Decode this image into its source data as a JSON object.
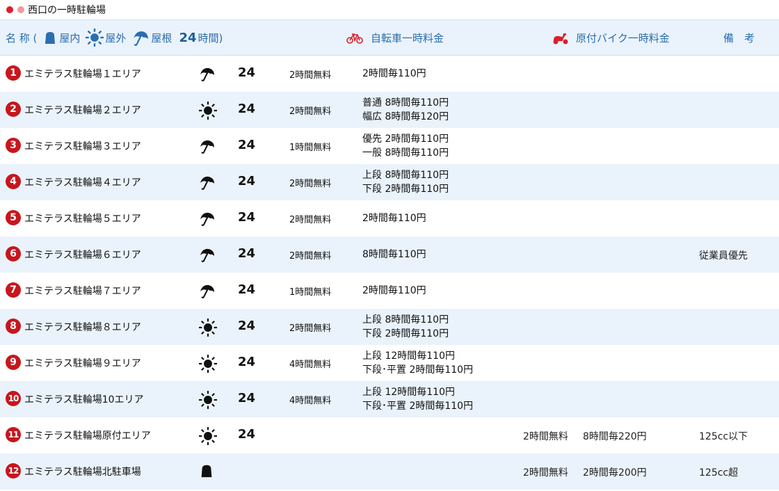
{
  "title": "西口の一時駐輪場",
  "header": {
    "name_label": "名 称 (",
    "indoor_label": "屋内",
    "outdoor_label": "屋外",
    "roof_label": "屋根",
    "hours_num": "24",
    "hours_label": "時間)",
    "bicycle_label": "自転車一時料金",
    "moped_label": "原付バイク一時料金",
    "note_label": "備　考"
  },
  "colors": {
    "accent": "#2a6db0",
    "badge": "#c8161d",
    "row_alt": "#eaf3fb"
  },
  "rows": [
    {
      "num": "1",
      "name": "エミテラス駐輪場１エリア",
      "icon": "umbrella-icon",
      "hours": "24",
      "free": "2時間無料",
      "fee": [
        "2時間毎110円"
      ],
      "moto_free": "",
      "moto_fee": "",
      "note": ""
    },
    {
      "num": "2",
      "name": "エミテラス駐輪場２エリア",
      "icon": "sun-icon",
      "hours": "24",
      "free": "2時間無料",
      "fee": [
        "普通 8時間毎110円",
        "幅広 8時間毎120円"
      ],
      "moto_free": "",
      "moto_fee": "",
      "note": ""
    },
    {
      "num": "3",
      "name": "エミテラス駐輪場３エリア",
      "icon": "umbrella-icon",
      "hours": "24",
      "free": "1時間無料",
      "fee": [
        "優先 2時間毎110円",
        "一般 8時間毎110円"
      ],
      "moto_free": "",
      "moto_fee": "",
      "note": ""
    },
    {
      "num": "4",
      "name": "エミテラス駐輪場４エリア",
      "icon": "umbrella-icon",
      "hours": "24",
      "free": "2時間無料",
      "fee": [
        "上段 8時間毎110円",
        "下段 2時間毎110円"
      ],
      "moto_free": "",
      "moto_fee": "",
      "note": ""
    },
    {
      "num": "5",
      "name": "エミテラス駐輪場５エリア",
      "icon": "umbrella-icon",
      "hours": "24",
      "free": "2時間無料",
      "fee": [
        "2時間毎110円"
      ],
      "moto_free": "",
      "moto_fee": "",
      "note": ""
    },
    {
      "num": "6",
      "name": "エミテラス駐輪場６エリア",
      "icon": "umbrella-icon",
      "hours": "24",
      "free": "2時間無料",
      "fee": [
        "8時間毎110円"
      ],
      "moto_free": "",
      "moto_fee": "",
      "note": "従業員優先"
    },
    {
      "num": "7",
      "name": "エミテラス駐輪場７エリア",
      "icon": "umbrella-icon",
      "hours": "24",
      "free": "1時間無料",
      "fee": [
        "2時間毎110円"
      ],
      "moto_free": "",
      "moto_fee": "",
      "note": ""
    },
    {
      "num": "8",
      "name": "エミテラス駐輪場８エリア",
      "icon": "sun-icon",
      "hours": "24",
      "free": "2時間無料",
      "fee": [
        "上段 8時間毎110円",
        "下段 2時間毎110円"
      ],
      "moto_free": "",
      "moto_fee": "",
      "note": ""
    },
    {
      "num": "9",
      "name": "エミテラス駐輪場９エリア",
      "icon": "sun-icon",
      "hours": "24",
      "free": "4時間無料",
      "fee": [
        "上段 12時間毎110円",
        "下段･平置 2時間毎110円"
      ],
      "moto_free": "",
      "moto_fee": "",
      "note": ""
    },
    {
      "num": "10",
      "name": "エミテラス駐輪場10エリア",
      "icon": "sun-icon",
      "hours": "24",
      "free": "4時間無料",
      "fee": [
        "上段 12時間毎110円",
        "下段･平置 2時間毎110円"
      ],
      "moto_free": "",
      "moto_fee": "",
      "note": ""
    },
    {
      "num": "11",
      "name": "エミテラス駐輪場原付エリア",
      "icon": "sun-icon",
      "hours": "24",
      "free": "",
      "fee": [],
      "moto_free": "2時間無料",
      "moto_fee": "8時間毎220円",
      "note": "125cc以下"
    },
    {
      "num": "12",
      "name": "エミテラス駐輪場北駐車場",
      "icon": "building-icon",
      "hours": "",
      "free": "",
      "fee": [],
      "moto_free": "2時間無料",
      "moto_fee": "2時間毎200円",
      "note": "125cc超"
    }
  ]
}
